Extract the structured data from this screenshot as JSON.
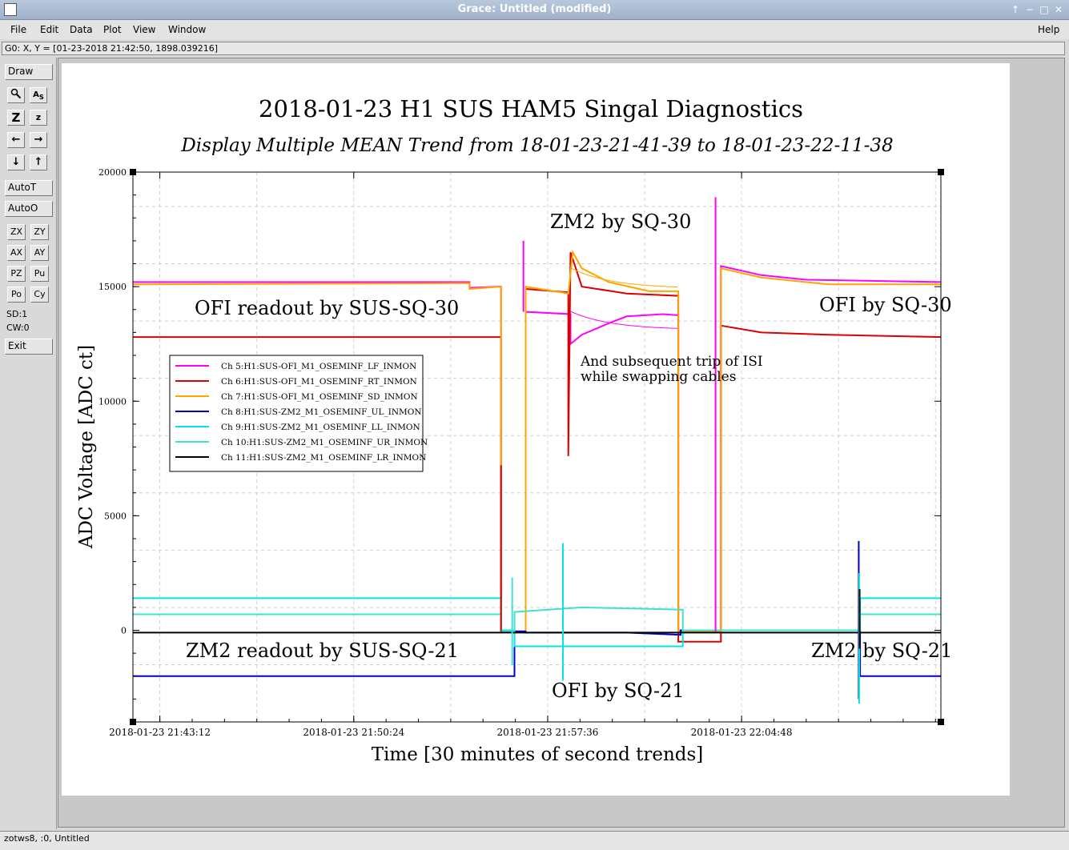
{
  "window": {
    "title": "Grace: Untitled (modified)"
  },
  "menu": {
    "file": "File",
    "edit": "Edit",
    "data": "Data",
    "plot": "Plot",
    "view": "View",
    "window": "Window",
    "help": "Help"
  },
  "locator": "G0: X, Y = [01-23-2018 21:42:50, 1898.039216]",
  "toolbar": {
    "draw": "Draw",
    "autot": "AutoT",
    "autoo": "AutoO",
    "zx": "ZX",
    "zy": "ZY",
    "ax": "AX",
    "ay": "AY",
    "pz": "PZ",
    "pu": "Pu",
    "po": "Po",
    "cy": "Cy",
    "sd": "SD:1",
    "cw": "CW:0",
    "exit": "Exit",
    "icons": [
      "zoom-icon",
      "autoscale-text-icon",
      "zoom-in-icon",
      "zoom-out-icon",
      "left-arrow-icon",
      "right-arrow-icon",
      "down-arrow-icon",
      "up-arrow-icon"
    ]
  },
  "status": "zotws8, :0, Untitled",
  "chart_data": {
    "type": "line",
    "title": "2018-01-23 H1 SUS HAM5 Singal Diagnostics",
    "subtitle": "Display Multiple MEAN Trend from 18-01-23-21-41-39 to 18-01-23-22-11-38",
    "xlabel": "Time [30 minutes of second trends]",
    "ylabel": "ADC Voltage [ADC ct]",
    "xlim": [
      0,
      1800
    ],
    "ylim": [
      -4000,
      20000
    ],
    "y_ticks": [
      0,
      5000,
      10000,
      15000,
      20000
    ],
    "y_tick_labels": [
      "0",
      "5000",
      "10000",
      "15000",
      "20000"
    ],
    "x_ticks": [
      60,
      492,
      924,
      1356
    ],
    "x_tick_labels": [
      "2018-01-23 21:43:12",
      "2018-01-23 21:50:24",
      "2018-01-23 21:57:36",
      "2018-01-23 22:04:48"
    ],
    "grid": true,
    "legend_position": "left",
    "annotations": [
      "OFI readout by SUS-SQ-30",
      "ZM2 by SQ-30",
      "OFI by SQ-30",
      "And subsequent trip of ISI",
      "while swapping cables",
      "ZM2 readout by SUS-SQ-21",
      "OFI by SQ-21",
      "ZM2 by SQ-21"
    ],
    "series": [
      {
        "name": "Ch 5:H1:SUS-OFI_M1_OSEMINF_LF_INMON",
        "color": "#ff00ff",
        "points": [
          [
            0,
            15200
          ],
          [
            750,
            15200
          ],
          [
            750,
            14950
          ],
          [
            820,
            15000
          ],
          [
            820,
            -50
          ],
          [
            875,
            -50
          ],
          [
            875,
            13900
          ],
          [
            975,
            13800
          ],
          [
            975,
            12500
          ],
          [
            1000,
            12900
          ],
          [
            1060,
            13400
          ],
          [
            1100,
            13700
          ],
          [
            1180,
            13800
          ],
          [
            1215,
            13750
          ],
          [
            1215,
            -50
          ],
          [
            1310,
            -50
          ],
          [
            1310,
            15900
          ],
          [
            1400,
            15500
          ],
          [
            1500,
            15300
          ],
          [
            1800,
            15200
          ]
        ]
      },
      {
        "name": "Ch 6:H1:SUS-OFI_M1_OSEMINF_RT_INMON",
        "color": "#dd0000",
        "points": [
          [
            0,
            12800
          ],
          [
            750,
            12800
          ],
          [
            820,
            12800
          ],
          [
            820,
            -50
          ],
          [
            875,
            -50
          ],
          [
            875,
            14900
          ],
          [
            970,
            14750
          ],
          [
            970,
            7600
          ],
          [
            975,
            16500
          ],
          [
            1000,
            15000
          ],
          [
            1100,
            14700
          ],
          [
            1215,
            14600
          ],
          [
            1215,
            -500
          ],
          [
            1310,
            -500
          ],
          [
            1310,
            13300
          ],
          [
            1400,
            13000
          ],
          [
            1550,
            12900
          ],
          [
            1800,
            12800
          ]
        ]
      },
      {
        "name": "Ch 7:H1:SUS-OFI_M1_OSEMINF_SD_INMON",
        "color": "#ffa500",
        "points": [
          [
            0,
            15100
          ],
          [
            750,
            15150
          ],
          [
            750,
            14900
          ],
          [
            820,
            15000
          ],
          [
            820,
            -50
          ],
          [
            875,
            -50
          ],
          [
            875,
            15000
          ],
          [
            970,
            14700
          ],
          [
            980,
            16500
          ],
          [
            1000,
            15800
          ],
          [
            1060,
            15200
          ],
          [
            1150,
            14800
          ],
          [
            1215,
            14800
          ],
          [
            1215,
            -50
          ],
          [
            1310,
            -50
          ],
          [
            1310,
            15800
          ],
          [
            1400,
            15400
          ],
          [
            1550,
            15100
          ],
          [
            1800,
            15100
          ]
        ]
      },
      {
        "name": "Ch 8:H1:SUS-ZM2_M1_OSEMINF_UL_INMON",
        "color": "#0000cc",
        "points": [
          [
            0,
            -2000
          ],
          [
            850,
            -2000
          ],
          [
            850,
            -50
          ],
          [
            875,
            -50
          ],
          [
            875,
            -100
          ],
          [
            1100,
            -100
          ],
          [
            1220,
            -200
          ],
          [
            1220,
            0
          ],
          [
            1620,
            0
          ],
          [
            1620,
            -2000
          ],
          [
            1800,
            -2000
          ]
        ]
      },
      {
        "name": "Ch 9:H1:SUS-ZM2_M1_OSEMINF_LL_INMON",
        "color": "#00e5ee",
        "points": [
          [
            0,
            1400
          ],
          [
            820,
            1400
          ],
          [
            820,
            0
          ],
          [
            850,
            0
          ],
          [
            850,
            -700
          ],
          [
            1225,
            -700
          ],
          [
            1225,
            0
          ],
          [
            1620,
            0
          ],
          [
            1620,
            1400
          ],
          [
            1800,
            1400
          ]
        ]
      },
      {
        "name": "Ch 10:H1:SUS-ZM2_M1_OSEMINF_UR_INMON",
        "color": "#40e0d0",
        "points": [
          [
            0,
            700
          ],
          [
            820,
            700
          ],
          [
            820,
            -50
          ],
          [
            850,
            -50
          ],
          [
            850,
            800
          ],
          [
            1000,
            1000
          ],
          [
            1225,
            900
          ],
          [
            1225,
            0
          ],
          [
            1620,
            0
          ],
          [
            1620,
            700
          ],
          [
            1800,
            700
          ]
        ]
      },
      {
        "name": "Ch 11:H1:SUS-ZM2_M1_OSEMINF_LR_INMON",
        "color": "#000000",
        "points": [
          [
            0,
            -100
          ],
          [
            1800,
            -100
          ]
        ]
      }
    ]
  }
}
